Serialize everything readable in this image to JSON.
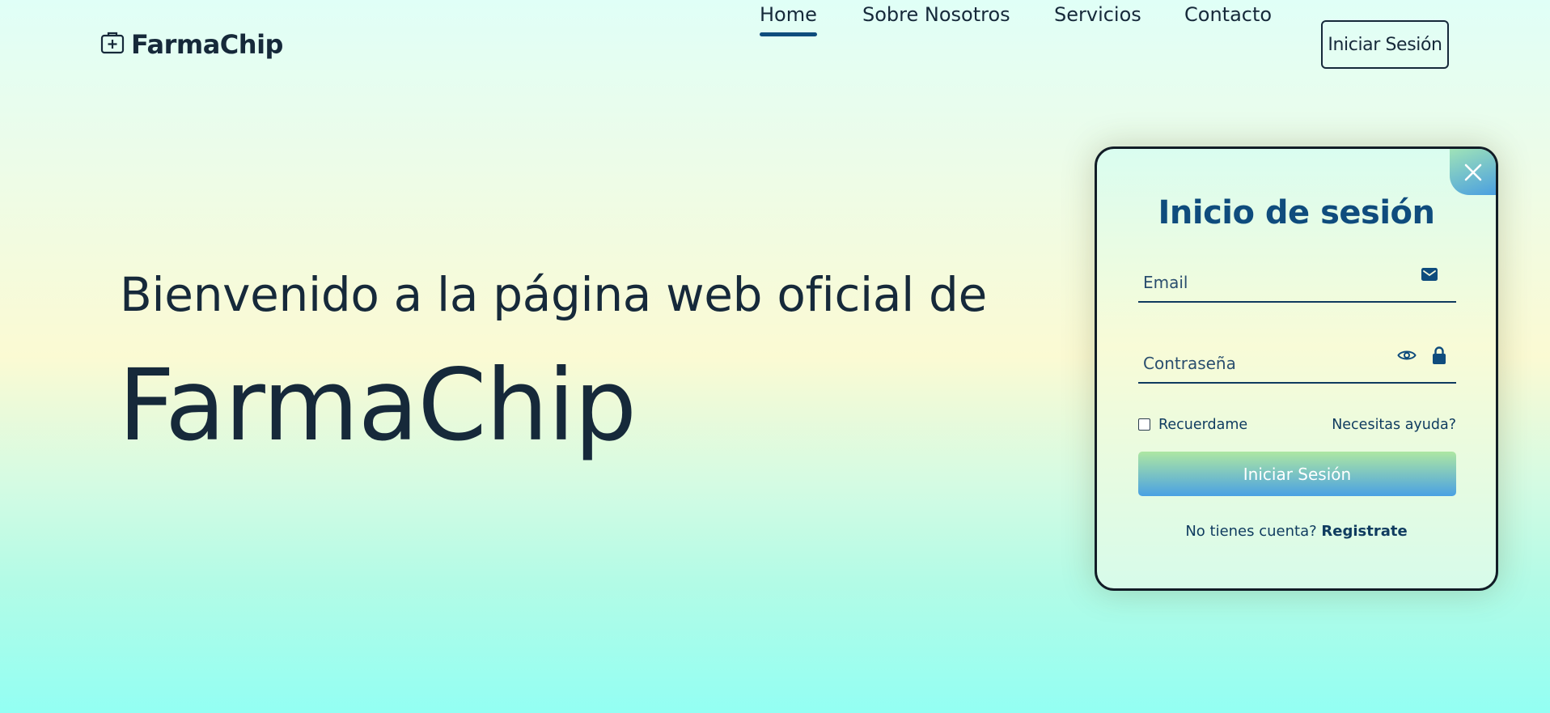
{
  "header": {
    "brand": "FarmaChip",
    "brand_icon": "medical-kit-icon",
    "nav": [
      {
        "label": "Home",
        "active": true
      },
      {
        "label": "Sobre Nosotros",
        "active": false
      },
      {
        "label": "Servicios",
        "active": false
      },
      {
        "label": "Contacto",
        "active": false
      }
    ],
    "login_button": "Iniciar Sesión"
  },
  "hero": {
    "subtitle": "Bienvenido a la página web oficial de",
    "title": "FarmaChip"
  },
  "login_card": {
    "title": "Inicio de sesión",
    "close_icon": "close-icon",
    "email_placeholder": "Email",
    "email_icon": "envelope-icon",
    "password_placeholder": "Contraseña",
    "password_icons": [
      "eye-icon",
      "lock-icon"
    ],
    "remember_label": "Recuerdame",
    "remember_checked": false,
    "help_link": "Necesitas ayuda?",
    "submit_label": "Iniciar Sesión",
    "register_prompt": "No tienes cuenta?",
    "register_link": "Registrate"
  },
  "colors": {
    "text_dark": "#16293a",
    "accent_blue": "#0f4c7d",
    "button_gradient_top": "#aee7a2",
    "button_gradient_bottom": "#4aa1e3"
  }
}
